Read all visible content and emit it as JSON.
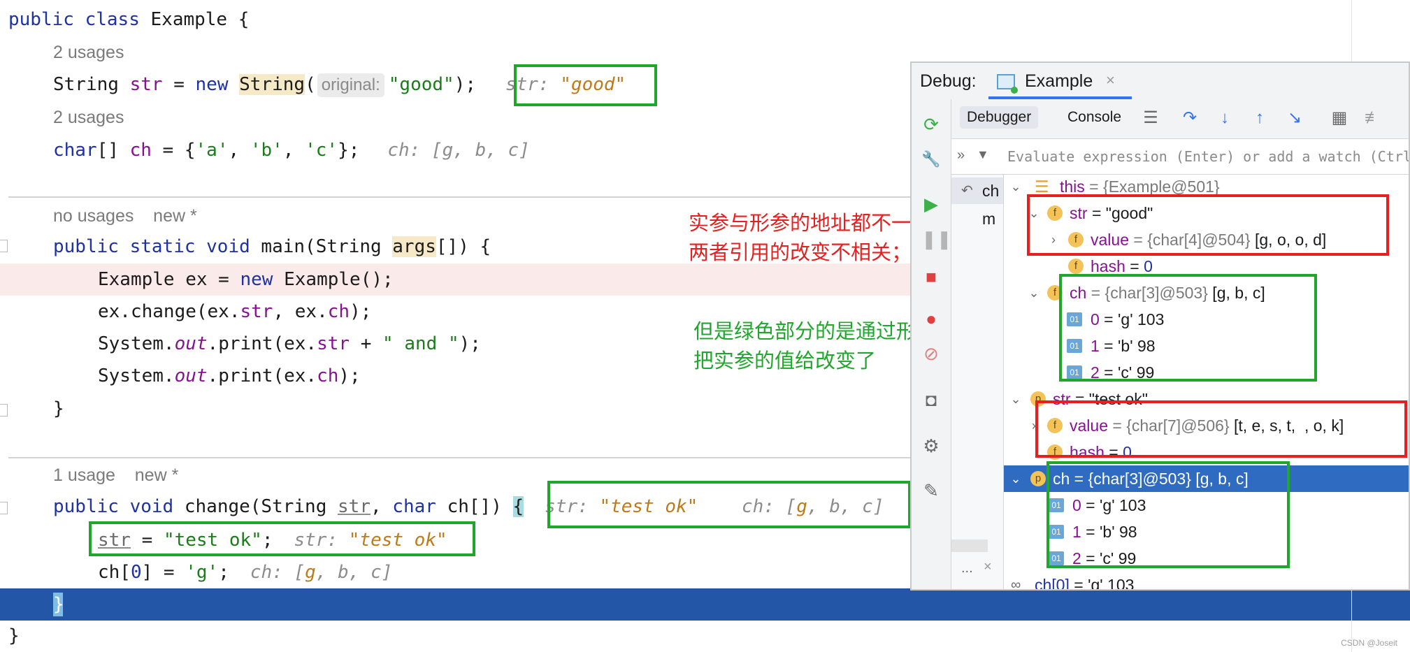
{
  "editor": {
    "line1": {
      "kw1": "public",
      "kw2": "class",
      "rest": " Example {"
    },
    "usage1": "2 usages",
    "line2": {
      "type": "String",
      "var": "str",
      "eq": " = ",
      "kw": "new",
      "ctor": "String",
      "paren": "(",
      "hint": "original:",
      "arg": "\"good\"",
      "end": ");",
      "val_label": "str: ",
      "val": "\"good\""
    },
    "usage2": "2 usages",
    "line3": {
      "type": "char",
      "brackets": "[] ",
      "var": "ch",
      "mid": " = {",
      "a": "'a'",
      "c1": ", ",
      "b": "'b'",
      "c2": ", ",
      "c": "'c'",
      "end": "};",
      "val": "ch: [g, b, c]"
    },
    "usage3a": "no usages",
    "usage3b": "new *",
    "line4": {
      "kw1": "public",
      "kw2": "static",
      "kw3": "void",
      "name": " main(String ",
      "args": "args",
      "rest": "[]) {"
    },
    "line5": {
      "pre": "Example ex = ",
      "kw": "new",
      "post": " Example();"
    },
    "line6": {
      "pre": "ex.change(ex.",
      "f1": "str",
      "mid": ", ex.",
      "f2": "ch",
      "post": ");"
    },
    "line7": {
      "pre": "System.",
      "out": "out",
      "mid": ".print(ex.",
      "f": "str",
      "mid2": " + ",
      "s": "\" and \"",
      "post": ");"
    },
    "line8": {
      "pre": "System.",
      "out": "out",
      "mid": ".print(ex.",
      "f": "ch",
      "post": ");"
    },
    "line9": "}",
    "usage4a": "1 usage",
    "usage4b": "new *",
    "line10": {
      "kw1": "public",
      "kw2": "void",
      "name": " change(String ",
      "p1": "str",
      "mid": ", ",
      "kw3": "char",
      "p2": " ch",
      "rest": "[]) ",
      "brace": "{",
      "val1_label": "str: ",
      "val1": "\"test ok\"",
      "val2_label": "ch: [",
      "val2_g": "g",
      "val2_rest": ", b, c]"
    },
    "line11": {
      "var": "str",
      "mid": " = ",
      "s": "\"test ok\"",
      "end": ";",
      "val_label": "str: ",
      "val": "\"test ok\""
    },
    "line12": {
      "pre": "ch[",
      "idx": "0",
      "mid": "] = ",
      "s": "'g'",
      "end": ";",
      "val_label": "ch: [",
      "val_g": "g",
      "val_rest": ", b, c]"
    },
    "line13": "}",
    "line14": "}"
  },
  "annotations": {
    "red": "实参与形参的地址都不一样，\n两者引用的改变不相关；",
    "green": "但是绿色部分的是通过形参，\n把实参的值给改变了"
  },
  "debug": {
    "label": "Debug:",
    "tab": "Example",
    "tab_close": "×",
    "toolbar_debugger": "Debugger",
    "toolbar_console": "Console",
    "eval_placeholder": "Evaluate expression (Enter) or add a watch (Ctrl",
    "frames": [
      "ch",
      "m"
    ],
    "frames_more": "...",
    "vars": [
      {
        "name": "this",
        "type": " = {Example@501}",
        "value": ""
      },
      {
        "name": "str",
        "type": " = ",
        "value": "\"good\""
      },
      {
        "name": "value",
        "type": " = {char[4]@504}",
        "value": " [g, o, o, d]"
      },
      {
        "name": "hash",
        "type": " = ",
        "value": "0"
      },
      {
        "name": "ch",
        "type": " = {char[3]@503}",
        "value": " [g, b, c]"
      },
      {
        "name": "0",
        "type": " = ",
        "value": "'g' 103"
      },
      {
        "name": "1",
        "type": " = ",
        "value": "'b' 98"
      },
      {
        "name": "2",
        "type": " = ",
        "value": "'c' 99"
      },
      {
        "name": "str",
        "type": " = ",
        "value": "\"test ok\""
      },
      {
        "name": "value",
        "type": " = {char[7]@506}",
        "value": " [t, e, s, t,  , o, k]"
      },
      {
        "name": "hash",
        "type": " = ",
        "value": "0"
      },
      {
        "name": "ch",
        "type": " = {char[3]@503}",
        "value": " [g, b, c]"
      },
      {
        "name": "0",
        "type": " = ",
        "value": "'g' 103"
      },
      {
        "name": "1",
        "type": " = ",
        "value": "'b' 98"
      },
      {
        "name": "2",
        "type": " = ",
        "value": "'c' 99"
      },
      {
        "name": "ch[0]",
        "type": " = ",
        "value": "'g' 103"
      }
    ]
  },
  "watermark": "CSDN @Joseit",
  "colors": {
    "green_box": "#1fa72b",
    "red_box": "#e62020",
    "exec_line": "#2456a8",
    "selection": "#2f6cc1"
  }
}
